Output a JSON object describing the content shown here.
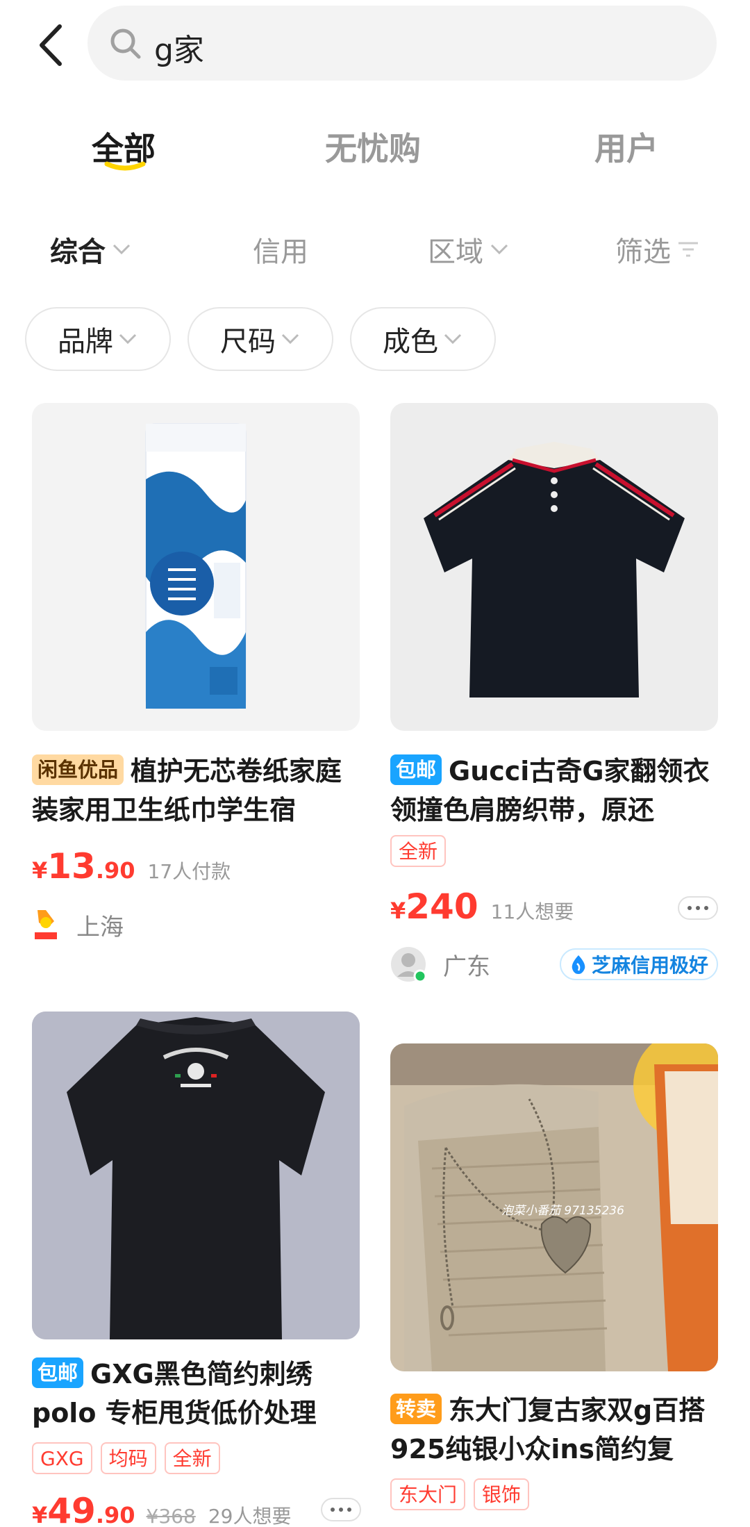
{
  "search": {
    "query": "g家"
  },
  "tabs": [
    {
      "label": "全部",
      "active": true
    },
    {
      "label": "无忧购",
      "active": false
    },
    {
      "label": "用户",
      "active": false
    }
  ],
  "sort": [
    {
      "label": "综合",
      "active": true
    },
    {
      "label": "信用"
    },
    {
      "label": "区域"
    },
    {
      "label": "筛选"
    }
  ],
  "filters": [
    "品牌",
    "尺码",
    "成色"
  ],
  "products": [
    {
      "badge": "闲鱼优品",
      "title": "植护无芯卷纸家庭装家用卫生纸巾学生宿",
      "price_int": "13",
      "price_dec": ".90",
      "meta": "17人付款",
      "location": "上海",
      "seller_icon": "haoshifa-logo"
    },
    {
      "badge": "包邮",
      "title": "Gucci古奇G家翻领衣领撞色肩膀织带，原还",
      "tags": [
        "全新"
      ],
      "price_int": "240",
      "price_dec": "",
      "meta": "11人想要",
      "location": "广东",
      "credit": "芝麻信用极好",
      "seller_icon": "avatar-icon"
    },
    {
      "badge": "包邮",
      "title": "GXG黑色简约刺绣polo 专柜甩货低价处理",
      "tags": [
        "GXG",
        "均码",
        "全新"
      ],
      "price_int": "49",
      "price_dec": ".90",
      "orig_price": "¥368",
      "meta": "29人想要"
    },
    {
      "badge": "转卖",
      "title": "东大门复古家双g百搭925纯银小众ins简约复",
      "tags": [
        "东大门",
        "银饰"
      ],
      "watermark": "泡菜小番茄 97135236"
    }
  ],
  "currency": "¥",
  "colors": {
    "accent": "#ff3b30",
    "brand_yellow": "#ffd400",
    "blue": "#19a4ff"
  }
}
